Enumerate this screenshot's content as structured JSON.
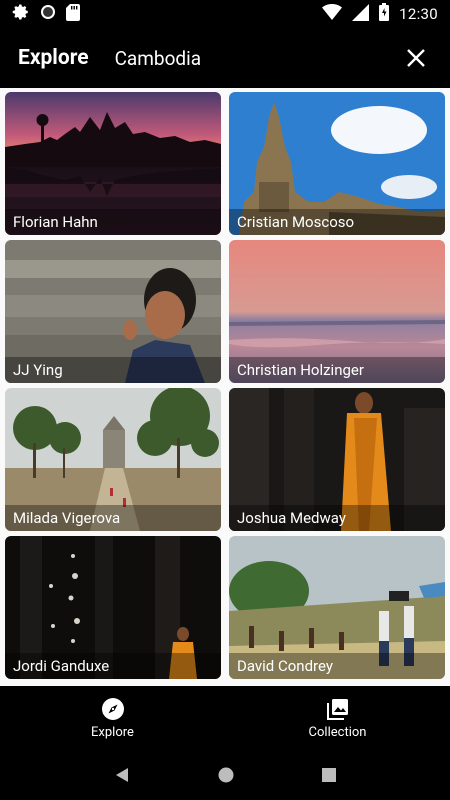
{
  "status_bar": {
    "time": "12:30",
    "left_icons": [
      "settings-icon",
      "circle-icon",
      "sd-card-icon"
    ],
    "right_icons": [
      "wifi-icon",
      "signal-icon",
      "battery-icon"
    ]
  },
  "app_bar": {
    "title": "Explore",
    "subtitle": "Cambodia",
    "close_icon": "close-icon"
  },
  "photos": [
    {
      "author": "Florian Hahn"
    },
    {
      "author": "Cristian Moscoso"
    },
    {
      "author": "JJ Ying"
    },
    {
      "author": "Christian Holzinger"
    },
    {
      "author": "Milada Vigerova"
    },
    {
      "author": "Joshua Medway"
    },
    {
      "author": "Jordi Ganduxe"
    },
    {
      "author": "David Condrey"
    }
  ],
  "bottom_nav": [
    {
      "label": "Explore",
      "icon": "compass-icon"
    },
    {
      "label": "Collection",
      "icon": "photo-library-icon"
    }
  ],
  "system_nav": [
    "back-icon",
    "home-icon",
    "recents-icon"
  ],
  "colors": {
    "background": "#000000",
    "grid_background": "#fafafa",
    "text": "#ffffff"
  }
}
